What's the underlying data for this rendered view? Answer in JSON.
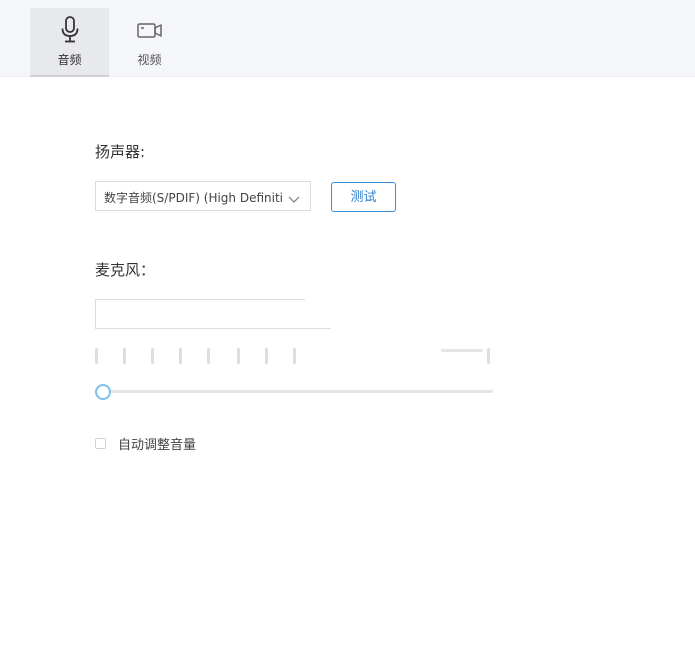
{
  "tabs": {
    "audio": {
      "label": "音频",
      "icon": "microphone-icon",
      "active": true
    },
    "video": {
      "label": "视频",
      "icon": "video-camera-icon",
      "active": false
    }
  },
  "speaker": {
    "label": "扬声器:",
    "selected_device": "数字音频(S/PDIF) (High Definition Audio Device)",
    "test_button_label": "测试"
  },
  "microphone": {
    "label": "麦克风：",
    "selected_device": "",
    "volume_level": 0,
    "input_level_bars": 8
  },
  "auto_adjust": {
    "label": "自动调整音量",
    "checked": false
  },
  "colors": {
    "accent": "#2b7fcc",
    "slider_thumb": "#7cc0f0",
    "topbar_bg": "#f5f6f9"
  }
}
